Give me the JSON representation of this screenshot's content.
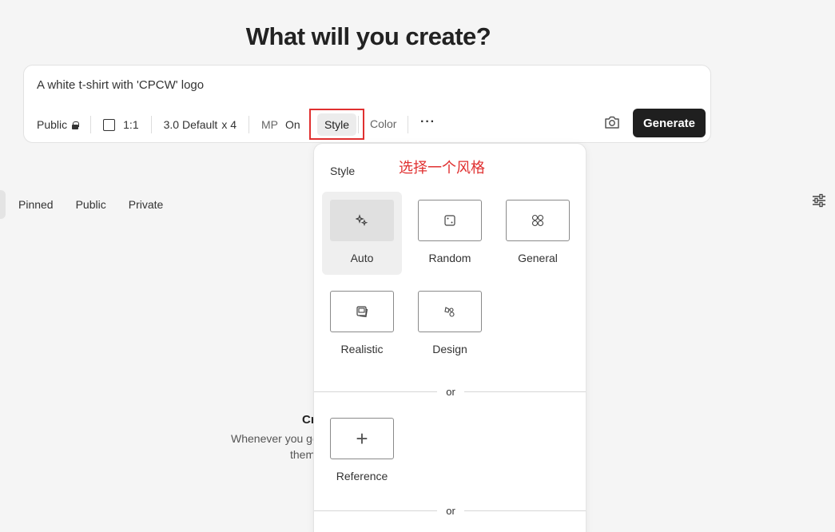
{
  "page": {
    "title": "What will you create?"
  },
  "prompt": {
    "value": "A white t-shirt with 'CPCW' logo"
  },
  "toolbar": {
    "visibility": "Public",
    "aspect_ratio": "1:1",
    "model": "3.0 Default",
    "count": "x 4",
    "mp_label": "MP",
    "mp_value": "On",
    "style_label": "Style",
    "color_label": "Color",
    "more_label": "···",
    "generate_label": "Generate"
  },
  "tabs": [
    "Pinned",
    "Public",
    "Private"
  ],
  "empty_state": {
    "title": "Cr",
    "desc_line1": "Whenever you ge",
    "desc_line2": "them"
  },
  "style_popover": {
    "title": "Style",
    "annotation": "选择一个风格",
    "options": [
      {
        "label": "Auto",
        "icon": "sparkle-icon",
        "selected": true
      },
      {
        "label": "Random",
        "icon": "dice-icon",
        "selected": false
      },
      {
        "label": "General",
        "icon": "grid-icon",
        "selected": false
      },
      {
        "label": "Realistic",
        "icon": "photo-icon",
        "selected": false
      },
      {
        "label": "Design",
        "icon": "palette-icon",
        "selected": false
      }
    ],
    "or_label_1": "or",
    "reference_label": "Reference",
    "or_label_2": "or"
  },
  "colors": {
    "accent_red": "#e03030",
    "generate_bg": "#1f1f1f",
    "background": "#f5f5f5"
  }
}
